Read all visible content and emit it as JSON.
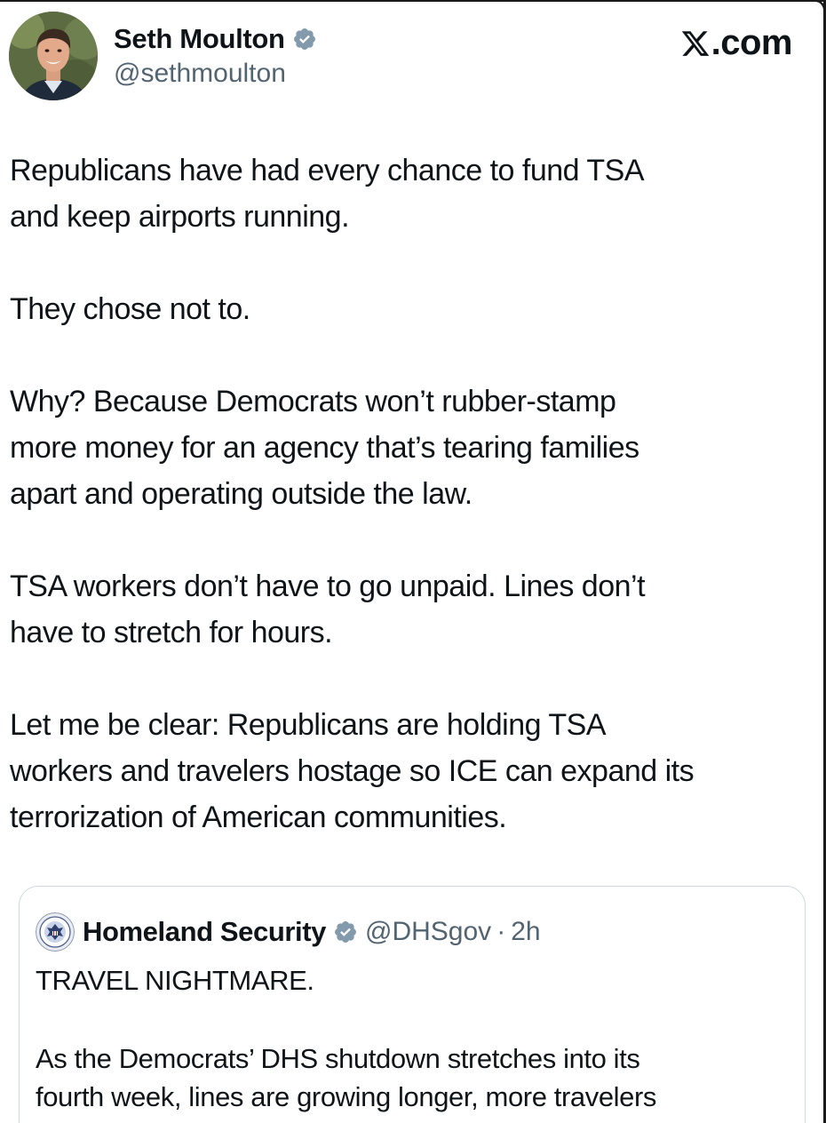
{
  "brand": {
    "label": ".com",
    "icon": "x-logo-icon"
  },
  "author": {
    "display_name": "Seth Moulton",
    "handle": "@sethmoulton",
    "verified_icon": "verified-badge-icon",
    "avatar": "profile-photo"
  },
  "tweet": {
    "paragraphs": [
      "Republicans have had every chance to fund TSA\nand keep airports running.",
      "They chose not to.",
      "Why? Because Democrats won’t rubber-stamp\nmore money for an agency that’s tearing families\napart and operating outside the law.",
      "TSA workers don’t have to go unpaid. Lines don’t\nhave to stretch for hours.",
      "Let me be clear: Republicans are holding TSA\nworkers and travelers hostage so ICE can expand its\nterrorization of American communities."
    ]
  },
  "quoted_tweet": {
    "display_name": "Homeland Security",
    "handle": "@DHSgov",
    "separator": "·",
    "time": "2h",
    "avatar": "dhs-seal-icon",
    "verified_icon": "verified-badge-icon",
    "paragraphs": [
      "TRAVEL NIGHTMARE.",
      "As the Democrats’ DHS shutdown stretches into its\nfourth week, lines are growing longer, more travelers"
    ]
  },
  "colors": {
    "text": "#0f1419",
    "secondary": "#536471",
    "verified_badge": "#829aab",
    "card_border": "#cfd9de"
  }
}
